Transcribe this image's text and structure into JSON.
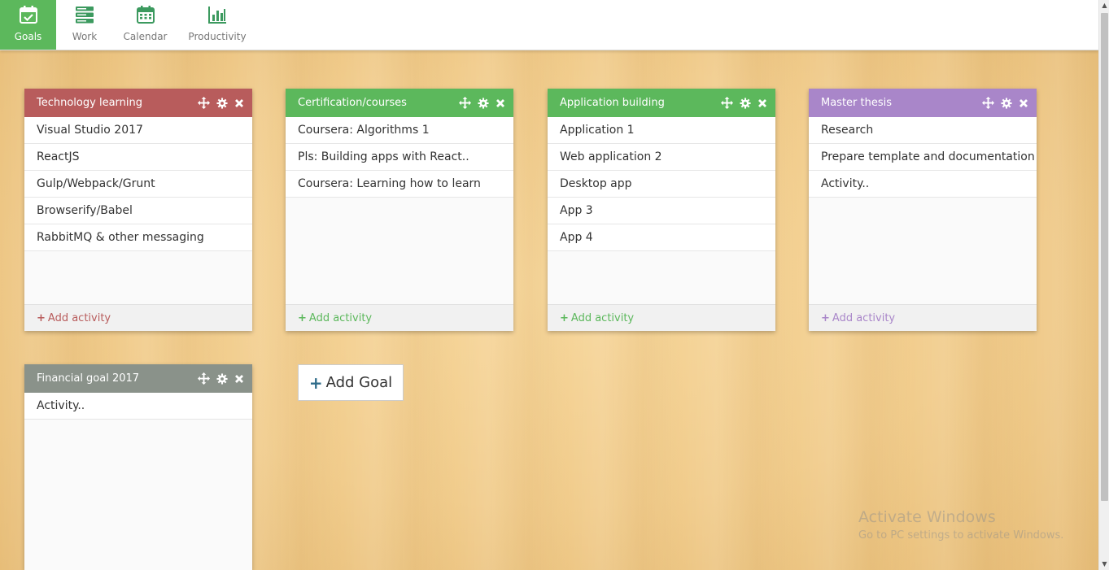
{
  "nav": {
    "items": [
      {
        "label": "Goals",
        "icon": "calendar-check-icon",
        "active": true
      },
      {
        "label": "Work",
        "icon": "server-icon",
        "active": false
      },
      {
        "label": "Calendar",
        "icon": "calendar-icon",
        "active": false
      },
      {
        "label": "Productivity",
        "icon": "bar-chart-icon",
        "active": false
      }
    ]
  },
  "cards": [
    {
      "title": "Technology learning",
      "color": "#b85c5c",
      "activities": [
        "Visual Studio 2017",
        "ReactJS",
        "Gulp/Webpack/Grunt",
        "Browserify/Babel",
        "RabbitMQ & other messaging"
      ],
      "add_label": "Add activity"
    },
    {
      "title": "Certification/courses",
      "color": "#5cb85c",
      "activities": [
        "Coursera: Algorithms 1",
        "Pls: Building apps with React..",
        "Coursera: Learning how to learn"
      ],
      "add_label": "Add activity"
    },
    {
      "title": "Application building",
      "color": "#5cb85c",
      "activities": [
        "Application 1",
        "Web application 2",
        "Desktop app",
        "App 3",
        "App 4"
      ],
      "add_label": "Add activity"
    },
    {
      "title": "Master thesis",
      "color": "#a986c9",
      "activities": [
        "Research",
        "Prepare template and documentation",
        "Activity.."
      ],
      "add_label": "Add activity"
    },
    {
      "title": "Financial goal 2017",
      "color": "#8a928a",
      "activities": [
        "Activity.."
      ],
      "add_label": ""
    }
  ],
  "add_goal_label": "Add Goal",
  "watermark": {
    "line1": "Activate Windows",
    "line2": "Go to PC settings to activate Windows."
  }
}
